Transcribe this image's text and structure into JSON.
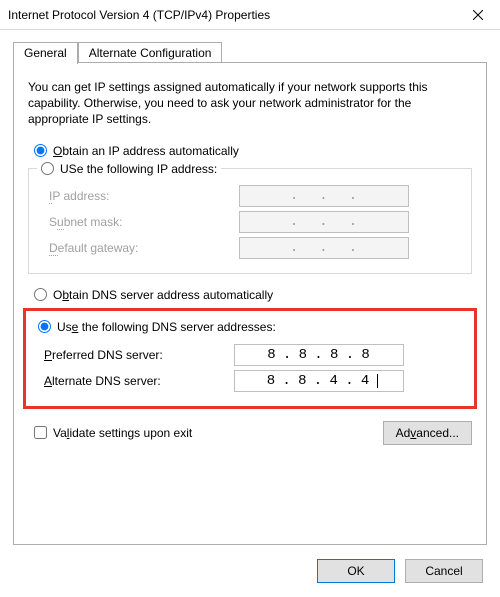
{
  "window": {
    "title": "Internet Protocol Version 4 (TCP/IPv4) Properties"
  },
  "tabs": {
    "general": "General",
    "alternate": "Alternate Configuration"
  },
  "intro": "You can get IP settings assigned automatically if your network supports this capability. Otherwise, you need to ask your network administrator for the appropriate IP settings.",
  "ip": {
    "auto_pre": "O",
    "auto_rest": "btain an IP address automatically",
    "manual_pre": "Use the following IP address:",
    "manual_u": "S",
    "fields": {
      "ip_pre": "I",
      "ip_rest": "P address:",
      "mask_pre": "S",
      "mask_u": "u",
      "mask_rest": "bnet mask:",
      "gw_pre": "D",
      "gw_rest": "efault gateway:"
    }
  },
  "dns": {
    "auto_pre": "O",
    "auto_u": "b",
    "auto_rest": "tain DNS server address automatically",
    "manual_pre": "Us",
    "manual_u": "e",
    "manual_rest": " the following DNS server addresses:",
    "pref": {
      "pre": "P",
      "rest": "referred DNS server:",
      "o1": "8",
      "o2": "8",
      "o3": "8",
      "o4": "8"
    },
    "alt": {
      "pre": "A",
      "rest": "lternate DNS server:",
      "o1": "8",
      "o2": "8",
      "o3": "4",
      "o4": "4"
    }
  },
  "validate": {
    "pre": "Va",
    "u": "l",
    "rest": "idate settings upon exit"
  },
  "buttons": {
    "advanced_pre": "Ad",
    "advanced_u": "v",
    "advanced_rest": "anced...",
    "ok": "OK",
    "cancel": "Cancel"
  }
}
